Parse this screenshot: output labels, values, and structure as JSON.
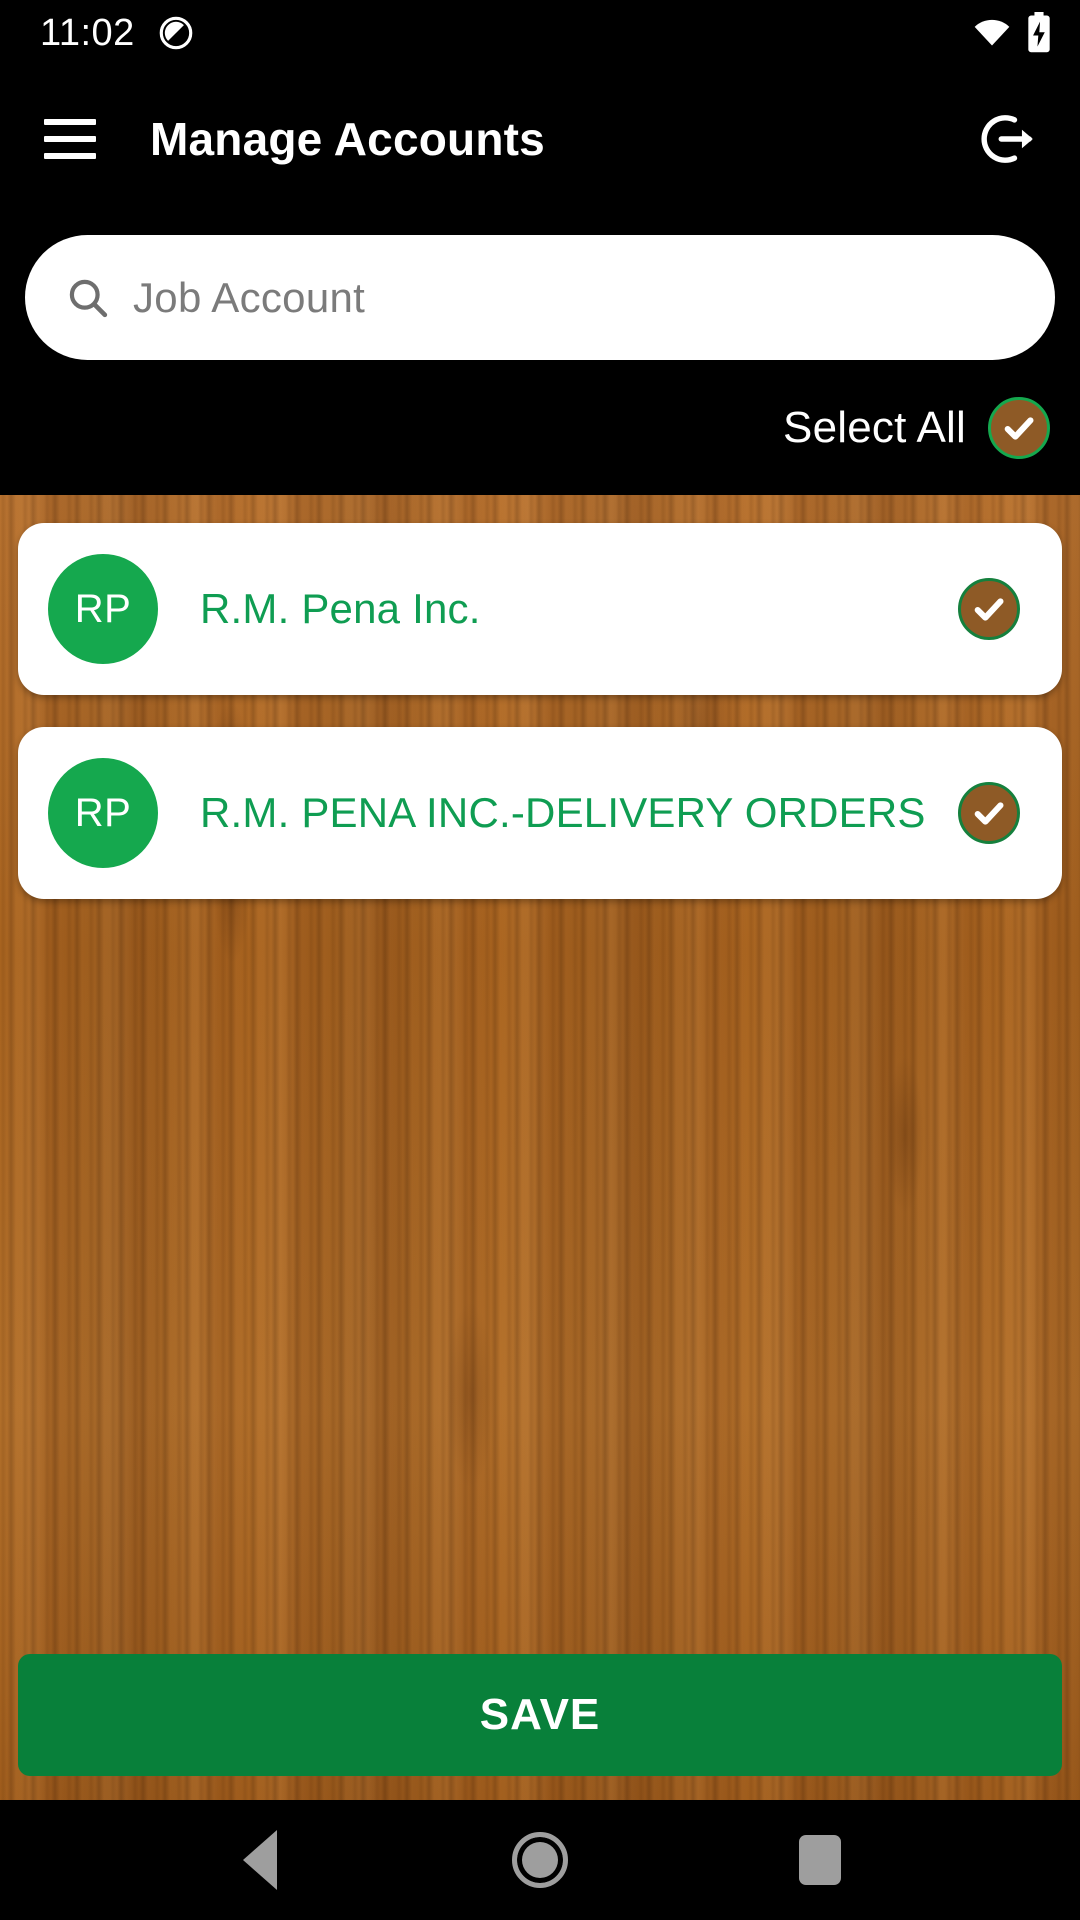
{
  "status_bar": {
    "time": "11:02",
    "icons": [
      "do-not-disturb-icon",
      "wifi-icon",
      "battery-charging-icon"
    ]
  },
  "app_bar": {
    "menu_icon": "hamburger-menu-icon",
    "title": "Manage Accounts",
    "logout_icon": "logout-icon"
  },
  "search": {
    "icon": "search-icon",
    "placeholder": "Job Account",
    "value": ""
  },
  "select_all": {
    "label": "Select All",
    "checked": true,
    "icon": "check-icon"
  },
  "accounts": [
    {
      "initials": "RP",
      "name": "R.M. Pena Inc.",
      "checked": true
    },
    {
      "initials": "RP",
      "name": "R.M. PENA INC.-DELIVERY ORDERS",
      "checked": true
    }
  ],
  "save_button": {
    "label": "SAVE"
  },
  "nav_bar": {
    "back": "back-triangle-icon",
    "home": "home-circle-icon",
    "recents": "recents-square-icon"
  },
  "colors": {
    "header_background": "#000000",
    "accent_green": "#15a84e",
    "text_green": "#0f9d52",
    "save_green": "#08803a",
    "checkbox_brown": "#8e5a26",
    "wood_background": "#b06a26",
    "card_background": "#ffffff",
    "placeholder_gray": "#7b7b7b",
    "nav_icon_gray": "#9e9e9e"
  }
}
